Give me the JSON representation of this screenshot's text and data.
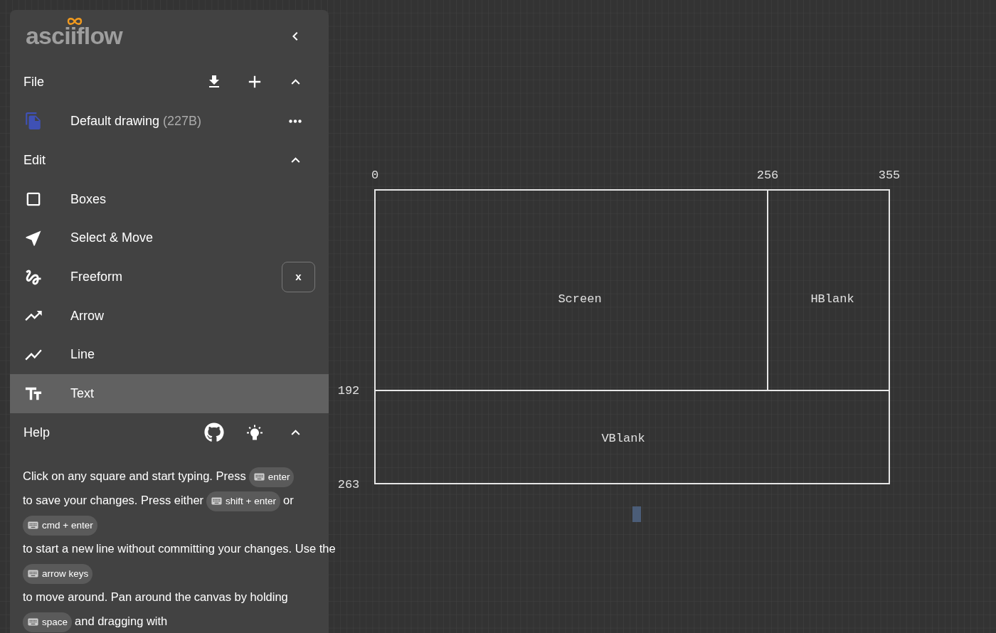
{
  "sidebar": {
    "logo": "asciiflow",
    "file": {
      "title": "File",
      "expanded": true,
      "drawing": {
        "name": "Default drawing",
        "size": "(227B)"
      }
    },
    "edit": {
      "title": "Edit",
      "expanded": true,
      "tools": [
        {
          "label": "Boxes",
          "selected": false
        },
        {
          "label": "Select & Move",
          "selected": false
        },
        {
          "label": "Freeform",
          "selected": false,
          "shortcut": "x"
        },
        {
          "label": "Arrow",
          "selected": false
        },
        {
          "label": "Line",
          "selected": false
        },
        {
          "label": "Text",
          "selected": true
        }
      ]
    },
    "help": {
      "title": "Help",
      "expanded": true,
      "text": [
        {
          "kind": "text",
          "text": "Click on any square and start typing. Press"
        },
        {
          "kind": "key",
          "text": "enter"
        },
        {
          "kind": "text",
          "text": "to save your changes. Press either"
        },
        {
          "kind": "key",
          "text": "shift + enter"
        },
        {
          "kind": "text",
          "text": "or"
        },
        {
          "kind": "key",
          "text": "cmd + enter"
        },
        {
          "kind": "text",
          "text": "to start a new"
        },
        {
          "kind": "text",
          "text": "line without committing your changes. Use the"
        },
        {
          "kind": "key",
          "text": "arrow keys"
        },
        {
          "kind": "text",
          "text": "to move around. Pan around the"
        },
        {
          "kind": "text",
          "text": "canvas by holding"
        },
        {
          "kind": "key",
          "text": "space"
        },
        {
          "kind": "text",
          "text": "and dragging with"
        }
      ]
    }
  },
  "canvas": {
    "labels": [
      "0",
      "256",
      "355",
      "192",
      "263"
    ],
    "boxes": [
      "Screen",
      "HBlank",
      "VBlank"
    ]
  }
}
